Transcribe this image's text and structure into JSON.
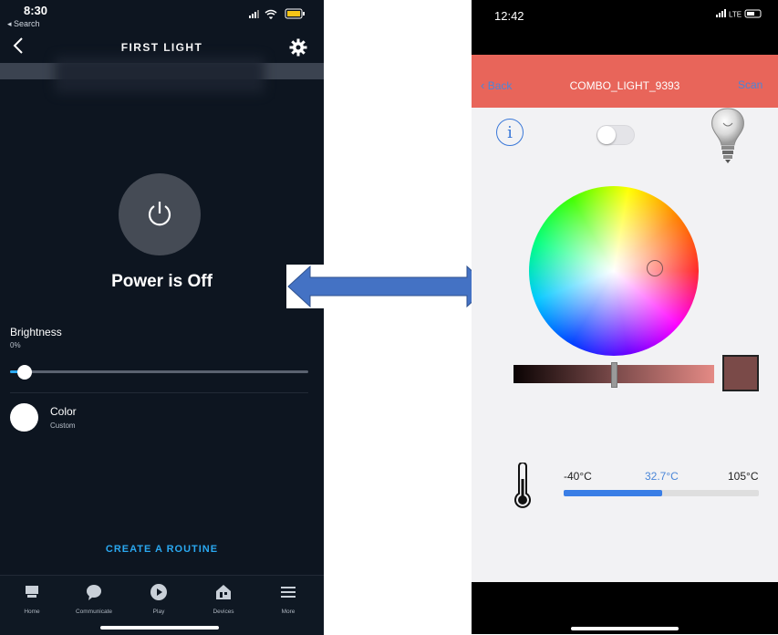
{
  "left_phone": {
    "status_time": "8:30",
    "status_back": "◂ Search",
    "title": "FIRST LIGHT",
    "power_status": "Power is Off",
    "brightness_label": "Brightness",
    "brightness_value": "0%",
    "brightness_fraction": 0.0,
    "color_label": "Color",
    "color_value": "Custom",
    "routine_link": "CREATE A ROUTINE",
    "nav": [
      {
        "label": "Home",
        "icon": "home-icon"
      },
      {
        "label": "Communicate",
        "icon": "chat-bubble-icon"
      },
      {
        "label": "Play",
        "icon": "play-icon"
      },
      {
        "label": "Devices",
        "icon": "devices-icon"
      },
      {
        "label": "More",
        "icon": "menu-icon"
      }
    ]
  },
  "right_phone": {
    "status_time": "12:42",
    "status_network": "LTE",
    "back_label": "Back",
    "title": "COMBO_LIGHT_9393",
    "scan_label": "Scan",
    "selected_color": "#7a4a48",
    "temperature": {
      "min": "-40°C",
      "current": "32.7°C",
      "max": "105°C"
    }
  },
  "colors": {
    "left_bg": "#0d1520",
    "accent_blue": "#2aa8f0",
    "header_red": "#e8655a",
    "arrow_blue": "#4472c4"
  }
}
